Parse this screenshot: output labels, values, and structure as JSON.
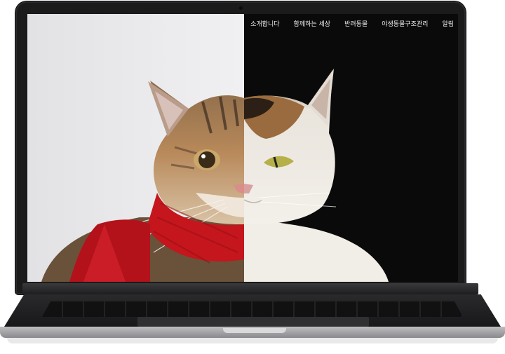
{
  "nav": {
    "items": [
      "소개합니다",
      "함께하는 세상",
      "반려동물",
      "야생동물구조관리",
      "알림"
    ]
  },
  "hero": {
    "left_cat": "tabby-cat-with-red-scarf",
    "right_cat": "calico-white-cat"
  },
  "colors": {
    "scarf": "#c4161c",
    "left_bg": "#e8e8ea",
    "right_bg": "#0b0a0a",
    "bezel": "#1b1b1c"
  }
}
